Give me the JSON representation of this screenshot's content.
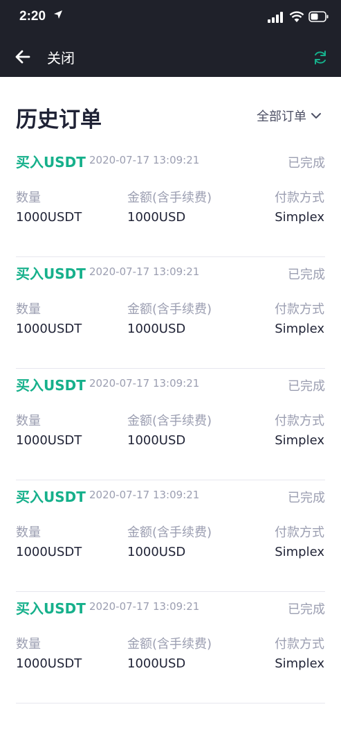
{
  "status_bar": {
    "time": "2:20"
  },
  "nav": {
    "close_label": "关闭"
  },
  "page": {
    "title": "历史订单",
    "filter_label": "全部订单"
  },
  "labels": {
    "quantity": "数量",
    "amount": "金额(含手续费)",
    "payment": "付款方式"
  },
  "orders": [
    {
      "type": "买入USDT",
      "time": "2020-07-17 13:09:21",
      "status": "已完成",
      "quantity": "1000USDT",
      "amount": "1000USD",
      "payment": "Simplex"
    },
    {
      "type": "买入USDT",
      "time": "2020-07-17 13:09:21",
      "status": "已完成",
      "quantity": "1000USDT",
      "amount": "1000USD",
      "payment": "Simplex"
    },
    {
      "type": "买入USDT",
      "time": "2020-07-17 13:09:21",
      "status": "已完成",
      "quantity": "1000USDT",
      "amount": "1000USD",
      "payment": "Simplex"
    },
    {
      "type": "买入USDT",
      "time": "2020-07-17 13:09:21",
      "status": "已完成",
      "quantity": "1000USDT",
      "amount": "1000USD",
      "payment": "Simplex"
    },
    {
      "type": "买入USDT",
      "time": "2020-07-17 13:09:21",
      "status": "已完成",
      "quantity": "1000USDT",
      "amount": "1000USD",
      "payment": "Simplex"
    }
  ],
  "colors": {
    "header_bg": "#1f212a",
    "accent": "#16b08b",
    "muted": "#9b9eb1",
    "text": "#1f2235"
  }
}
